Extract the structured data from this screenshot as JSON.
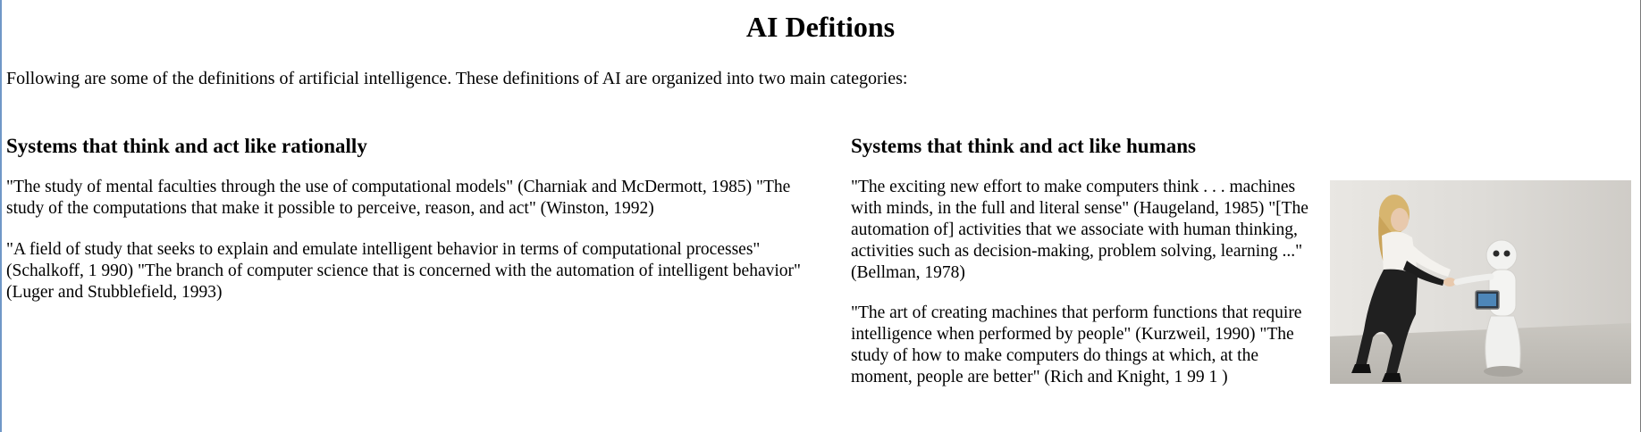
{
  "page": {
    "title": "AI Defitions",
    "intro": "Following are some of the definitions of artificial intelligence. These definitions of AI are organized into two main categories:"
  },
  "left_section": {
    "heading": "Systems that think and act like rationally",
    "paragraphs": [
      "\"The study of mental faculties through the use of computational models\" (Charniak and McDermott, 1985) \"The study of the computations that make it possible to perceive, reason, and act\" (Winston, 1992)",
      "\"A field of study that seeks to explain and emulate intelligent behavior in terms of computational processes\" (Schalkoff, 1 990) \"The branch of computer science that is concerned with the automation of intelligent behavior\" (Luger and Stubblefield, 1993)"
    ]
  },
  "right_section": {
    "heading": "Systems that think and act like humans",
    "paragraphs": [
      "\"The exciting new effort to make computers think . . . machines with minds, in the full and literal sense\" (Haugeland, 1985) \"[The automation of] activities that we associate with human thinking, activities such as decision-making, problem solving, learning ...\"(Bellman, 1978)",
      "\"The art of creating machines that perform functions that require intelligence when performed by people\" (Kurzweil, 1990) \"The study of how to make computers do things at which, at the moment, people are better\" (Rich and Knight, 1 99 1 )"
    ]
  },
  "image": {
    "icon": "woman-shaking-hands-with-robot-photo"
  }
}
